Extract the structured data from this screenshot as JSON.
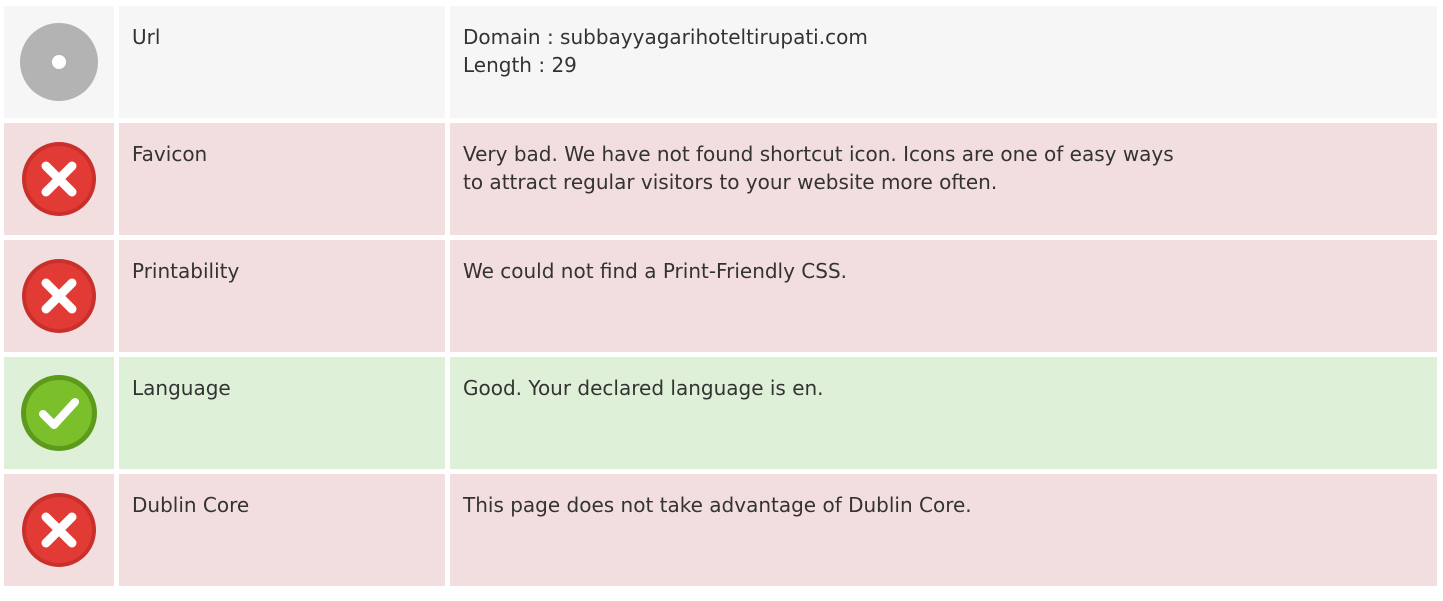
{
  "rows": [
    {
      "status": "neutral",
      "icon": "neutral-circle-icon",
      "label": "Url",
      "lines": [
        "Domain : subbayyagarihoteltirupati.com",
        "Length : 29"
      ]
    },
    {
      "status": "bad",
      "icon": "error-x-icon",
      "label": "Favicon",
      "lines": [
        "Very bad. We have not found shortcut icon. Icons are one of easy ways",
        "to attract regular visitors to your website more often."
      ]
    },
    {
      "status": "bad",
      "icon": "error-x-icon",
      "label": "Printability",
      "lines": [
        "We could not find a Print-Friendly CSS."
      ]
    },
    {
      "status": "good",
      "icon": "success-check-icon",
      "label": "Language",
      "lines": [
        "Good. Your declared language is en."
      ]
    },
    {
      "status": "bad",
      "icon": "error-x-icon",
      "label": "Dublin Core",
      "lines": [
        "This page does not take advantage of Dublin Core."
      ]
    }
  ],
  "colors": {
    "neutral_bg": "#f6f6f6",
    "bad_bg": "#f2dede",
    "good_bg": "#dff0d8",
    "error_icon": "#e23b35",
    "success_icon": "#7bbf2a",
    "neutral_icon": "#b3b3b3"
  }
}
